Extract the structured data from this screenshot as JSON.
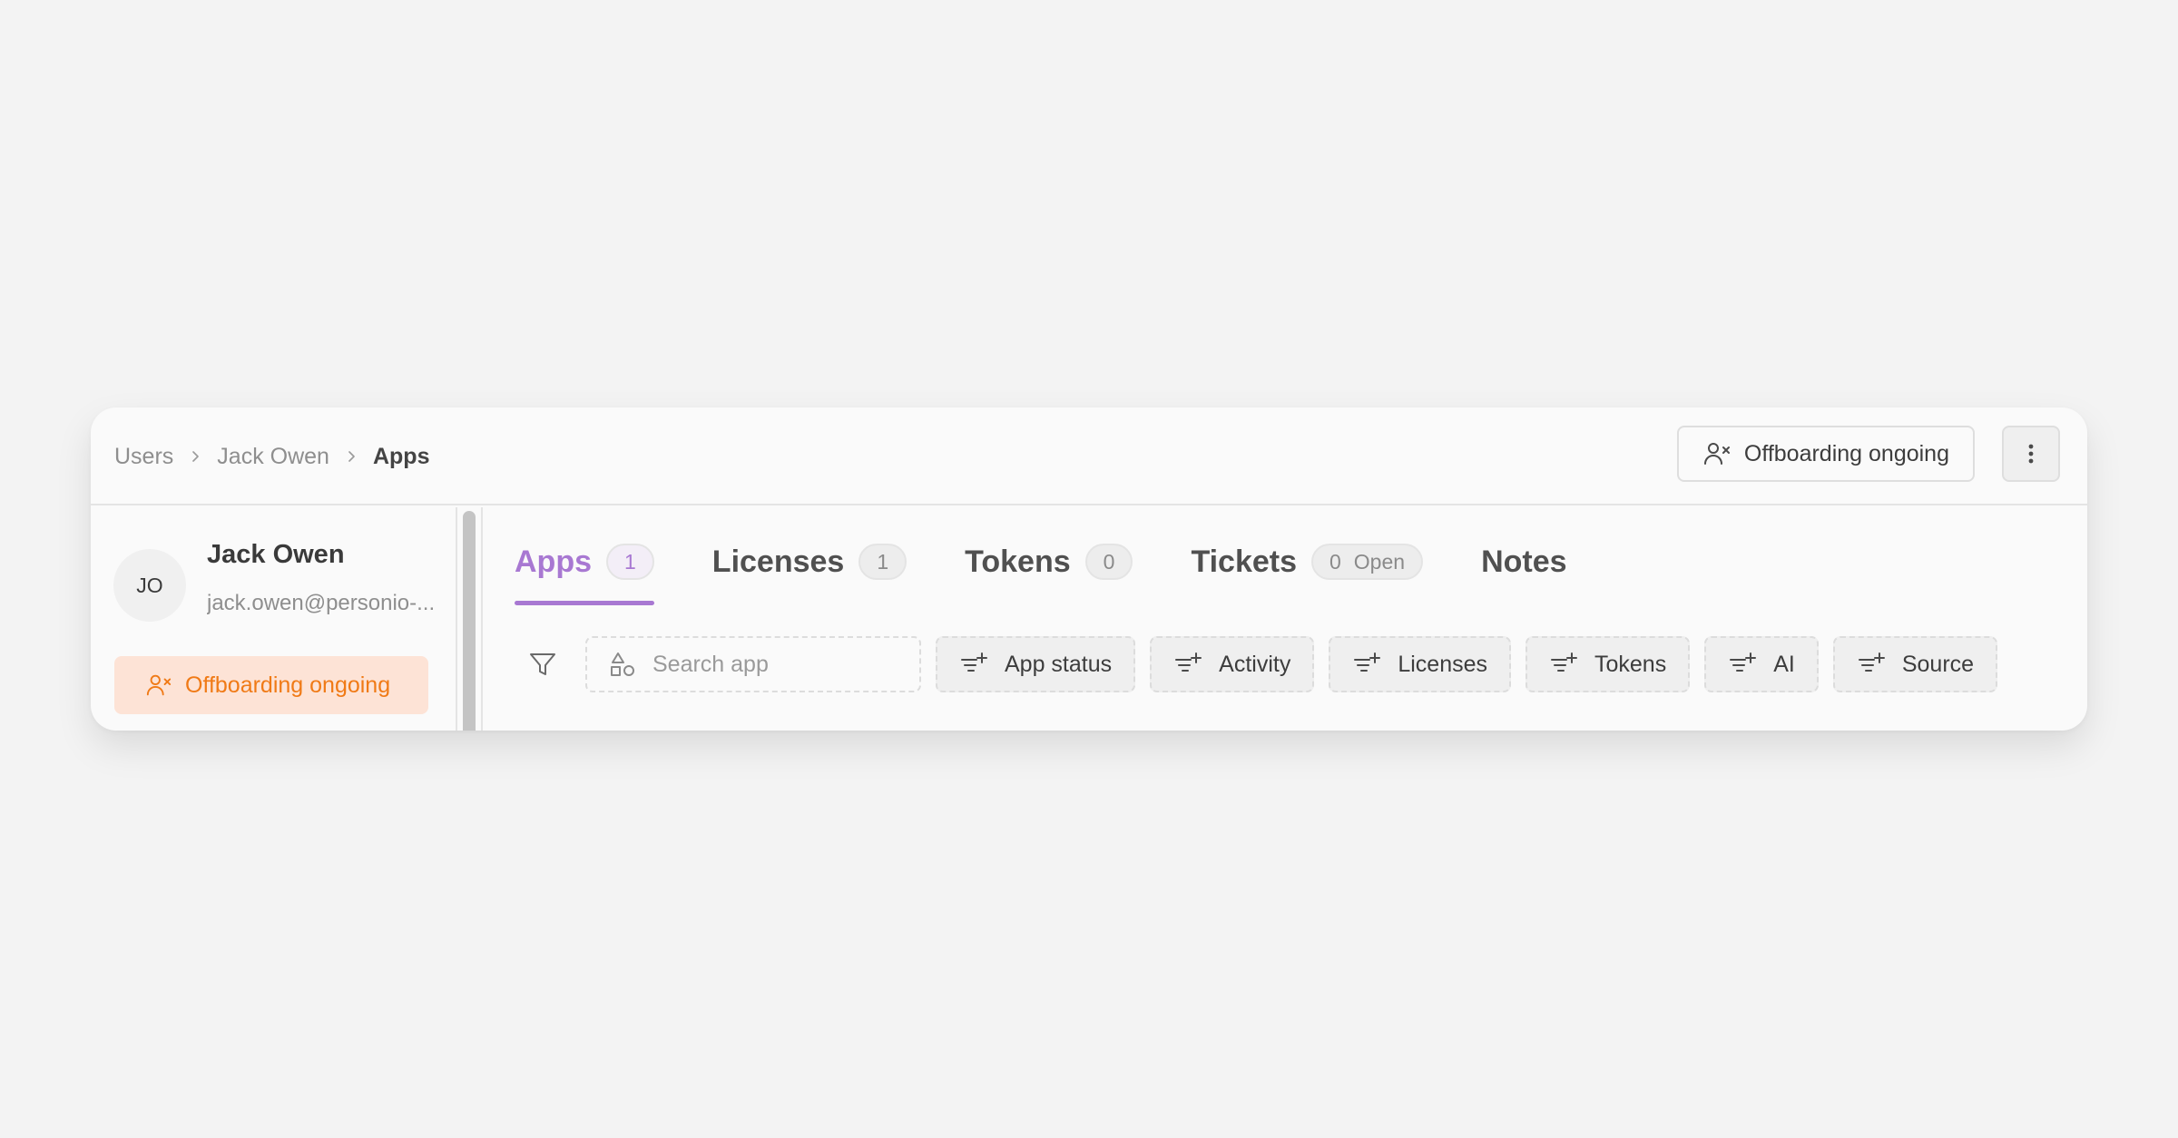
{
  "breadcrumb": {
    "items": [
      "Users",
      "Jack Owen",
      "Apps"
    ]
  },
  "header": {
    "status_button_label": "Offboarding ongoing",
    "more_icon": "more-vertical-icon"
  },
  "user": {
    "initials": "JO",
    "name": "Jack Owen",
    "email": "jack.owen@personio-...",
    "status_label": "Offboarding ongoing",
    "status_color": "#f07a16",
    "status_bg": "#fde3d6"
  },
  "tabs": [
    {
      "label": "Apps",
      "count": "1"
    },
    {
      "label": "Licenses",
      "count": "1"
    },
    {
      "label": "Tokens",
      "count": "0"
    },
    {
      "label": "Tickets",
      "count": "0",
      "suffix": "Open"
    },
    {
      "label": "Notes"
    }
  ],
  "active_tab": "Apps",
  "accent_color": "#a878d2",
  "filters": {
    "search_placeholder": "Search app",
    "chips": [
      "App status",
      "Activity",
      "Licenses",
      "Tokens",
      "AI",
      "Source"
    ]
  }
}
